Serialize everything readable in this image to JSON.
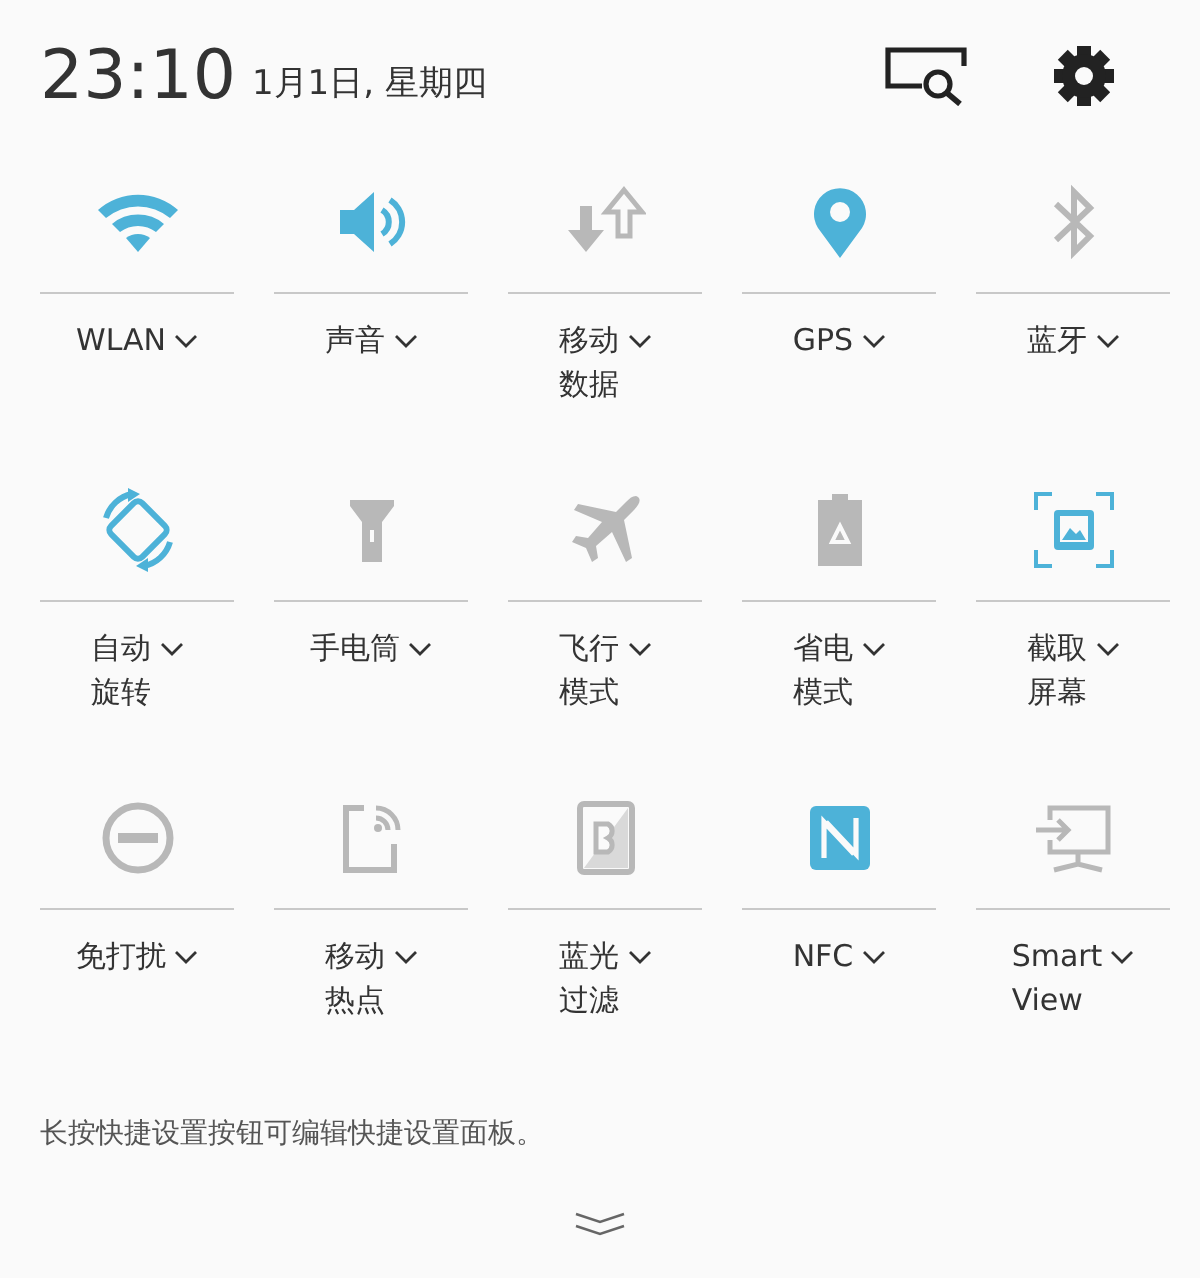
{
  "header": {
    "time": "23:10",
    "date": "1月1日, 星期四"
  },
  "tiles": [
    {
      "kind": "wifi",
      "on": true,
      "label_lines": [
        "WLAN"
      ]
    },
    {
      "kind": "sound",
      "on": true,
      "label_lines": [
        "声音"
      ]
    },
    {
      "kind": "data",
      "on": false,
      "label_lines": [
        "移动",
        "数据"
      ]
    },
    {
      "kind": "gps",
      "on": true,
      "label_lines": [
        "GPS"
      ]
    },
    {
      "kind": "bluetooth",
      "on": false,
      "label_lines": [
        "蓝牙"
      ]
    },
    {
      "kind": "rotate",
      "on": true,
      "label_lines": [
        "自动",
        "旋转"
      ]
    },
    {
      "kind": "flashlight",
      "on": false,
      "label_lines": [
        "手电筒"
      ]
    },
    {
      "kind": "airplane",
      "on": false,
      "label_lines": [
        "飞行",
        "模式"
      ]
    },
    {
      "kind": "powersave",
      "on": false,
      "label_lines": [
        "省电",
        "模式"
      ]
    },
    {
      "kind": "screenshot",
      "on": true,
      "label_lines": [
        "截取",
        "屏幕"
      ]
    },
    {
      "kind": "dnd",
      "on": false,
      "label_lines": [
        "免打扰"
      ]
    },
    {
      "kind": "hotspot",
      "on": false,
      "label_lines": [
        "移动",
        "热点"
      ]
    },
    {
      "kind": "bluefilter",
      "on": false,
      "label_lines": [
        "蓝光",
        "过滤"
      ]
    },
    {
      "kind": "nfc",
      "on": true,
      "label_lines": [
        "NFC"
      ]
    },
    {
      "kind": "smartview",
      "on": false,
      "label_lines": [
        "Smart",
        "View"
      ]
    }
  ],
  "hint": "长按快捷设置按钮可编辑快捷设置面板。"
}
